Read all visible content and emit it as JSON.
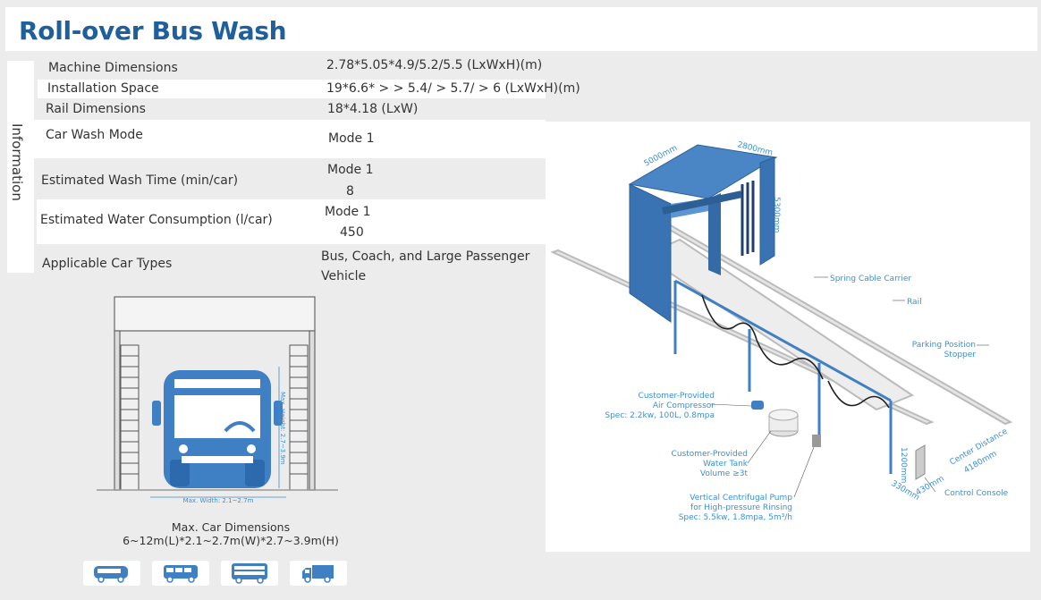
{
  "title": "Roll-over Bus Wash",
  "info_tab": "Information",
  "specs": [
    {
      "label": "Machine Dimensions",
      "value": "2.78*5.05*4.9/5.2/5.5 (LxWxH)(m)"
    },
    {
      "label": "Installation Space",
      "value": "19*6.6* > > 5.4/ > 5.7/ > 6 (LxWxH)(m)"
    },
    {
      "label": "Rail Dimensions",
      "value": "18*4.18 (LxW)"
    },
    {
      "label": "Car Wash Mode",
      "value": "Mode 1"
    },
    {
      "label": "Estimated Wash Time (min/car)",
      "value_line1": "Mode 1",
      "value_line2": "8"
    },
    {
      "label": "Estimated Water Consumption (l/car)",
      "value_line1": "Mode 1",
      "value_line2": "450"
    },
    {
      "label": "Applicable Car Types",
      "value_line1": "Bus, Coach, and Large Passenger",
      "value_line2": "Vehicle"
    }
  ],
  "bus_figure": {
    "max_height_label": "Max. Height: 2.7~3.9m",
    "max_width_label": "Max. Width: 2.1~2.7m"
  },
  "max_car": {
    "line1": "Max. Car Dimensions",
    "line2": "6~12m(L)*2.1~2.7m(W)*2.7~3.9m(H)"
  },
  "vehicle_icons": [
    "bus-side-icon",
    "coach-icon",
    "double-decker-icon",
    "truck-icon"
  ],
  "diagram": {
    "dim_width": "5000mm",
    "dim_length": "2800mm",
    "dim_height": "5300mm",
    "spring_cable": "Spring Cable Carrier",
    "rail": "Rail",
    "stopper_line1": "Parking Position",
    "stopper_line2": "Stopper",
    "compressor_line1": "Customer-Provided",
    "compressor_line2": "Air Compressor",
    "compressor_line3": "Spec: 2.2kw, 100L, 0.8mpa",
    "tank_line1": "Customer-Provided",
    "tank_line2": "Water Tank",
    "tank_line3": "Volume ≥3t",
    "pump_line1": "Vertical Centrifugal Pump",
    "pump_line2": "for High-pressure Rinsing",
    "pump_line3": "Spec: 5.5kw, 1.8mpa, 5m³/h",
    "center_line1": "Center Distance",
    "center_line2": "4180mm",
    "console": "Control Console",
    "dim_330": "330mm",
    "dim_430": "430mm",
    "dim_1200": "1200mm"
  },
  "colors": {
    "title": "#1f5f9c",
    "machine": "#3f7fc4",
    "accent": "#3b8fd6"
  }
}
